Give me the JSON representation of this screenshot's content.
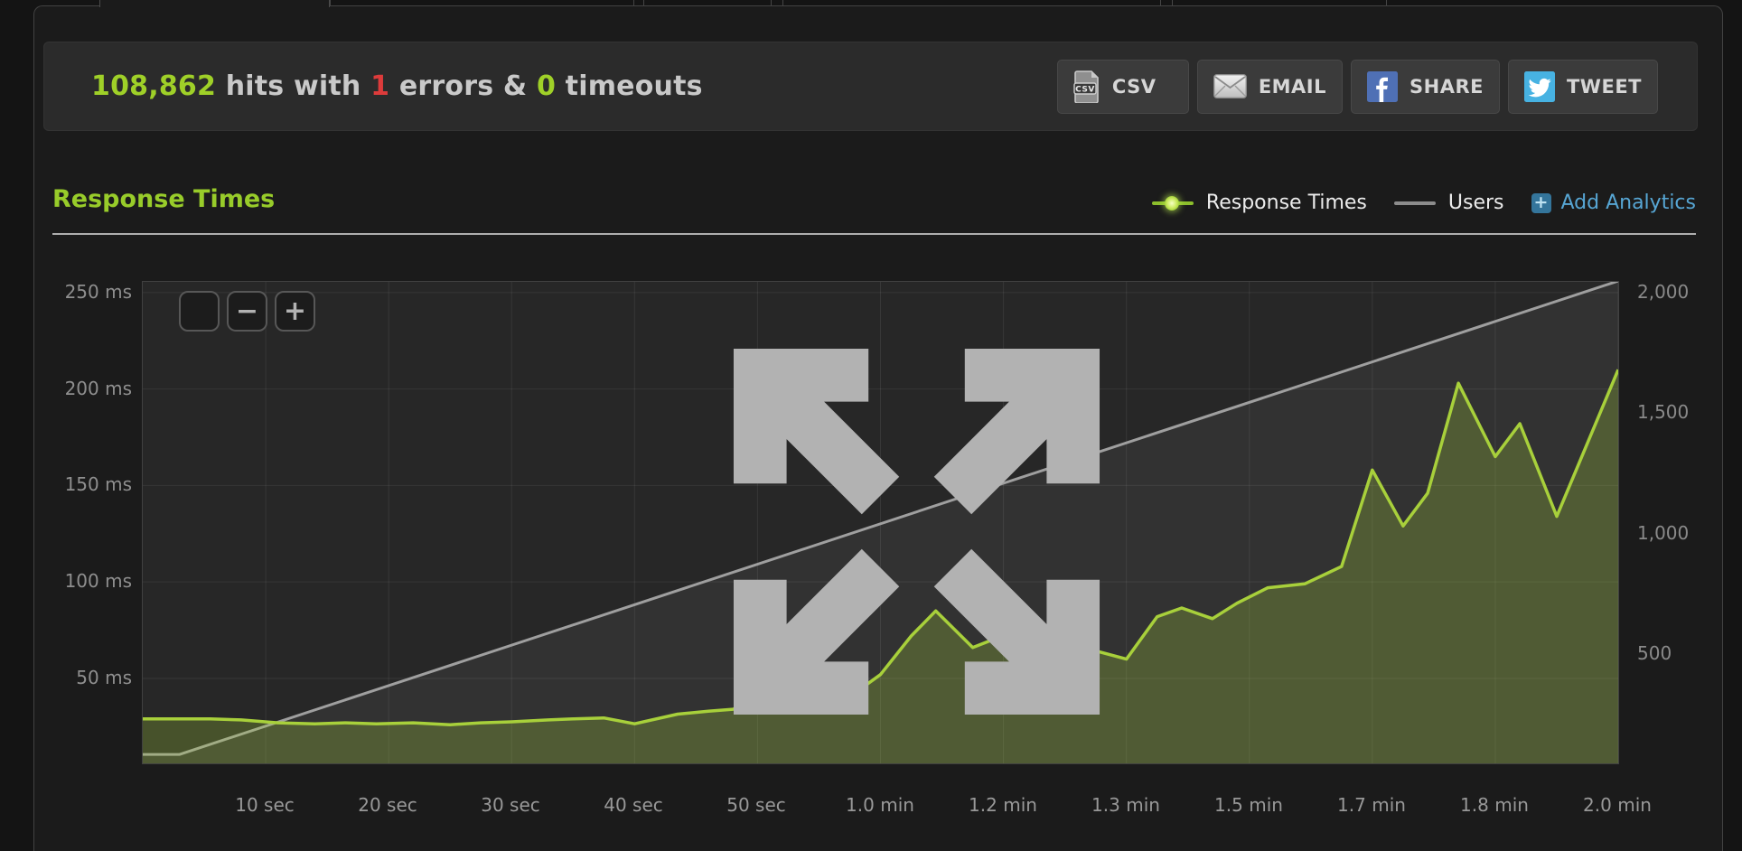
{
  "summary": {
    "hits_value": "108,862",
    "hits_label": "hits with",
    "errors_value": "1",
    "errors_label": "errors &",
    "timeouts_value": "0",
    "timeouts_label": "timeouts"
  },
  "toolbar": {
    "buttons": [
      {
        "label": "CSV",
        "icon": "csv-file-icon"
      },
      {
        "label": "EMAIL",
        "icon": "email-envelope-icon"
      },
      {
        "label": "SHARE",
        "icon": "facebook-icon"
      },
      {
        "label": "TWEET",
        "icon": "twitter-bird-icon"
      }
    ]
  },
  "section": {
    "heading": "Response Times"
  },
  "legend": {
    "response_times_label": "Response Times",
    "users_label": "Users",
    "add_analytics_label": "Add Analytics",
    "plus_glyph": "+"
  },
  "chart_controls": {
    "zoom_out_glyph": "−",
    "zoom_in_glyph": "+"
  },
  "colors": {
    "accent_green": "#9fd028",
    "error_red": "#dc3b3b",
    "response_line": "#a8d03b",
    "response_fill": "rgba(167,207,58,0.26)",
    "users_line": "#9f9f9f",
    "users_fill": "rgba(255,255,255,0.055)",
    "analytics_blue": "#57a6d4"
  },
  "chart_data": {
    "type": "line",
    "title": "Response Times",
    "x_unit": "seconds",
    "x_range": [
      0,
      120
    ],
    "grid": true,
    "legend_position": "top-right",
    "x_ticks": [
      10,
      20,
      30,
      40,
      50,
      60,
      70,
      80,
      90,
      100,
      110,
      120
    ],
    "x_tick_labels": [
      "10 sec",
      "20 sec",
      "30 sec",
      "40 sec",
      "50 sec",
      "1.0 min",
      "1.2 min",
      "1.3 min",
      "1.5 min",
      "1.7 min",
      "1.8 min",
      "2.0 min"
    ],
    "y_left": {
      "unit": "ms",
      "lim": [
        0,
        256
      ],
      "ticks": [
        50,
        100,
        150,
        200,
        250
      ],
      "tick_labels": [
        "50 ms",
        "100 ms",
        "150 ms",
        "200 ms",
        "250 ms"
      ]
    },
    "y_right": {
      "unit": "users",
      "lim": [
        0,
        2048
      ],
      "ticks": [
        500,
        1000,
        1500,
        2000
      ],
      "tick_labels": [
        "500",
        "1,000",
        "1,500",
        "2,000"
      ]
    },
    "series": [
      {
        "name": "Response Times",
        "axis": "left",
        "unit": "ms",
        "points": [
          [
            0,
            29
          ],
          [
            3,
            29
          ],
          [
            5.5,
            29
          ],
          [
            8,
            28.5
          ],
          [
            11,
            27
          ],
          [
            14,
            26.5
          ],
          [
            16.5,
            27
          ],
          [
            19,
            26.5
          ],
          [
            22,
            27
          ],
          [
            25,
            26
          ],
          [
            27.5,
            27
          ],
          [
            30,
            27.5
          ],
          [
            33,
            28.5
          ],
          [
            35,
            29
          ],
          [
            37.5,
            29.5
          ],
          [
            40,
            26.5
          ],
          [
            43.5,
            31.5
          ],
          [
            46,
            33
          ],
          [
            48,
            34
          ],
          [
            50,
            39
          ],
          [
            52.5,
            36.5
          ],
          [
            55,
            44.5
          ],
          [
            57.5,
            40.5
          ],
          [
            60,
            52
          ],
          [
            62.5,
            72
          ],
          [
            64.5,
            85
          ],
          [
            67.5,
            66
          ],
          [
            69.5,
            71
          ],
          [
            72,
            66
          ],
          [
            74.5,
            64.5
          ],
          [
            76.5,
            66
          ],
          [
            80,
            60
          ],
          [
            82.5,
            82
          ],
          [
            84.5,
            86.5
          ],
          [
            87,
            81
          ],
          [
            89,
            89
          ],
          [
            91.5,
            97
          ],
          [
            94.5,
            99
          ],
          [
            97.5,
            108
          ],
          [
            100,
            158
          ],
          [
            102.5,
            129
          ],
          [
            104.5,
            146
          ],
          [
            107,
            203
          ],
          [
            110,
            165
          ],
          [
            112,
            182
          ],
          [
            115,
            134
          ],
          [
            120,
            210
          ]
        ]
      },
      {
        "name": "Users",
        "axis": "right",
        "unit": "users",
        "points": [
          [
            0,
            85
          ],
          [
            3,
            85
          ],
          [
            120,
            2048
          ]
        ]
      }
    ]
  }
}
